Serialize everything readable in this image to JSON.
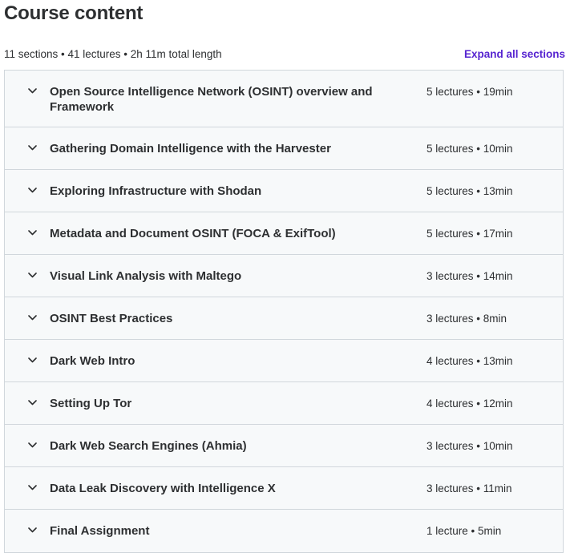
{
  "header": {
    "title": "Course content",
    "summary": "11 sections • 41 lectures • 2h 11m total length",
    "expand_all_label": "Expand all sections"
  },
  "colors": {
    "accent": "#5624d0",
    "text": "#2d2f31",
    "section_bg": "#f7f9fa",
    "border": "#d1d7dc"
  },
  "sections": [
    {
      "title": "Open Source Intelligence Network (OSINT) overview and Framework",
      "meta": "5 lectures • 19min",
      "icon": "chevron-down-icon"
    },
    {
      "title": "Gathering Domain Intelligence with the Harvester",
      "meta": "5 lectures • 10min",
      "icon": "chevron-down-icon"
    },
    {
      "title": "Exploring Infrastructure with Shodan",
      "meta": "5 lectures • 13min",
      "icon": "chevron-down-icon"
    },
    {
      "title": "Metadata and Document OSINT (FOCA & ExifTool)",
      "meta": "5 lectures • 17min",
      "icon": "chevron-down-icon"
    },
    {
      "title": "Visual Link Analysis with Maltego",
      "meta": "3 lectures • 14min",
      "icon": "chevron-down-icon"
    },
    {
      "title": "OSINT Best Practices",
      "meta": "3 lectures • 8min",
      "icon": "chevron-down-icon"
    },
    {
      "title": "Dark Web Intro",
      "meta": "4 lectures • 13min",
      "icon": "chevron-down-icon"
    },
    {
      "title": "Setting Up Tor",
      "meta": "4 lectures • 12min",
      "icon": "chevron-down-icon"
    },
    {
      "title": "Dark Web Search Engines (Ahmia)",
      "meta": "3 lectures • 10min",
      "icon": "chevron-down-icon"
    },
    {
      "title": "Data Leak Discovery with Intelligence X",
      "meta": "3 lectures • 11min",
      "icon": "chevron-down-icon"
    },
    {
      "title": "Final Assignment",
      "meta": "1 lecture • 5min",
      "icon": "chevron-down-icon"
    }
  ]
}
